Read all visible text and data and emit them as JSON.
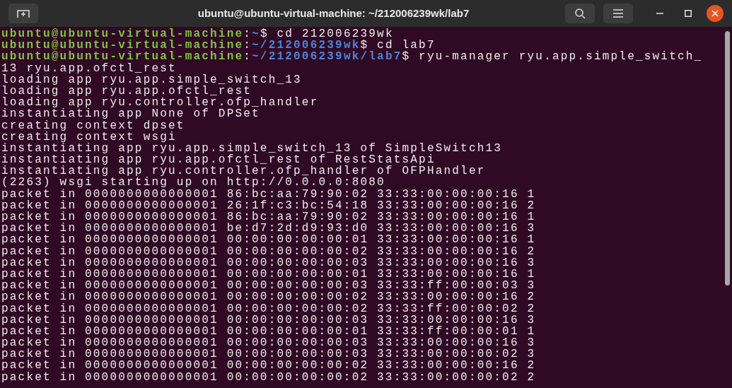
{
  "window": {
    "title": "ubuntu@ubuntu-virtual-machine: ~/212006239wk/lab7"
  },
  "terminal": {
    "lines": [
      {
        "kind": "prompt",
        "user": "ubuntu@ubuntu-virtual-machine",
        "sep": ":",
        "path": "~",
        "command": "$ cd 212006239wk"
      },
      {
        "kind": "prompt",
        "user": "ubuntu@ubuntu-virtual-machine",
        "sep": ":",
        "path": "~/212006239wk",
        "command": "$ cd lab7"
      },
      {
        "kind": "prompt",
        "user": "ubuntu@ubuntu-virtual-machine",
        "sep": ":",
        "path": "~/212006239wk/lab7",
        "command": "$ ryu-manager ryu.app.simple_switch_"
      },
      {
        "kind": "output",
        "text": "13 ryu.app.ofctl_rest"
      },
      {
        "kind": "output",
        "text": "loading app ryu.app.simple_switch_13"
      },
      {
        "kind": "output",
        "text": "loading app ryu.app.ofctl_rest"
      },
      {
        "kind": "output",
        "text": "loading app ryu.controller.ofp_handler"
      },
      {
        "kind": "output",
        "text": "instantiating app None of DPSet"
      },
      {
        "kind": "output",
        "text": "creating context dpset"
      },
      {
        "kind": "output",
        "text": "creating context wsgi"
      },
      {
        "kind": "output",
        "text": "instantiating app ryu.app.simple_switch_13 of SimpleSwitch13"
      },
      {
        "kind": "output",
        "text": "instantiating app ryu.app.ofctl_rest of RestStatsApi"
      },
      {
        "kind": "output",
        "text": "instantiating app ryu.controller.ofp_handler of OFPHandler"
      },
      {
        "kind": "output",
        "text": "(2263) wsgi starting up on http://0.0.0.0:8080"
      },
      {
        "kind": "output",
        "text": "packet in 0000000000000001 86:bc:aa:79:90:02 33:33:00:00:00:16 1"
      },
      {
        "kind": "output",
        "text": "packet in 0000000000000001 26:1f:c3:bc:54:18 33:33:00:00:00:16 2"
      },
      {
        "kind": "output",
        "text": "packet in 0000000000000001 86:bc:aa:79:90:02 33:33:00:00:00:16 1"
      },
      {
        "kind": "output",
        "text": "packet in 0000000000000001 be:d7:2d:d9:93:d0 33:33:00:00:00:16 3"
      },
      {
        "kind": "output",
        "text": "packet in 0000000000000001 00:00:00:00:00:01 33:33:00:00:00:16 1"
      },
      {
        "kind": "output",
        "text": "packet in 0000000000000001 00:00:00:00:00:02 33:33:00:00:00:16 2"
      },
      {
        "kind": "output",
        "text": "packet in 0000000000000001 00:00:00:00:00:03 33:33:00:00:00:16 3"
      },
      {
        "kind": "output",
        "text": "packet in 0000000000000001 00:00:00:00:00:01 33:33:00:00:00:16 1"
      },
      {
        "kind": "output",
        "text": "packet in 0000000000000001 00:00:00:00:00:03 33:33:ff:00:00:03 3"
      },
      {
        "kind": "output",
        "text": "packet in 0000000000000001 00:00:00:00:00:02 33:33:00:00:00:16 2"
      },
      {
        "kind": "output",
        "text": "packet in 0000000000000001 00:00:00:00:00:02 33:33:ff:00:00:02 2"
      },
      {
        "kind": "output",
        "text": "packet in 0000000000000001 00:00:00:00:00:03 33:33:00:00:00:16 3"
      },
      {
        "kind": "output",
        "text": "packet in 0000000000000001 00:00:00:00:00:01 33:33:ff:00:00:01 1"
      },
      {
        "kind": "output",
        "text": "packet in 0000000000000001 00:00:00:00:00:03 33:33:00:00:00:16 3"
      },
      {
        "kind": "output",
        "text": "packet in 0000000000000001 00:00:00:00:00:03 33:33:00:00:00:02 3"
      },
      {
        "kind": "output",
        "text": "packet in 0000000000000001 00:00:00:00:00:02 33:33:00:00:00:16 2"
      },
      {
        "kind": "output",
        "text": "packet in 0000000000000001 00:00:00:00:00:02 33:33:00:00:00:02 2"
      }
    ]
  }
}
